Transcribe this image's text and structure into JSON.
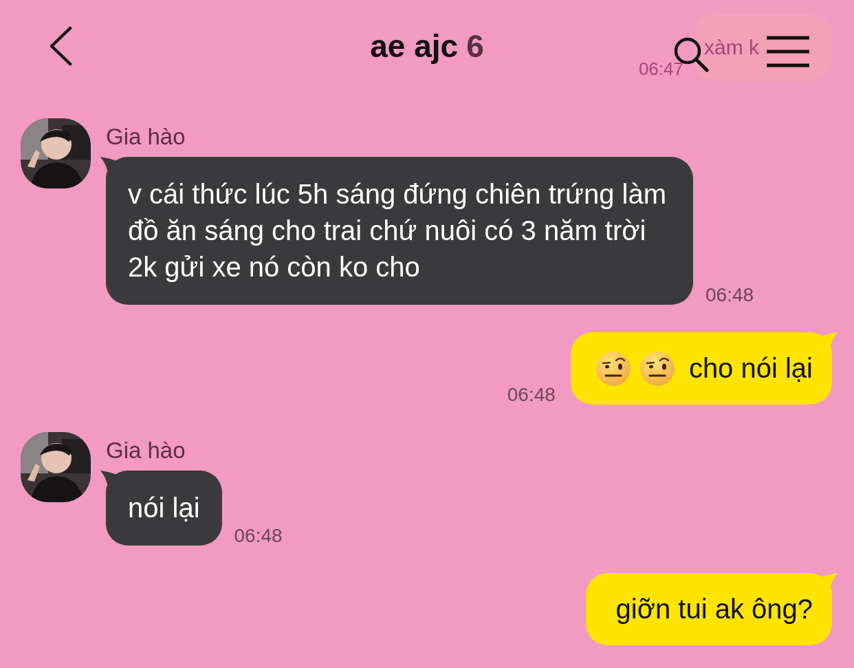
{
  "header": {
    "title": "ae ajc",
    "member_count": "6"
  },
  "faded_message": {
    "text": "xàm k",
    "time": "06:47"
  },
  "messages": [
    {
      "kind": "incoming",
      "sender": "Gia hào",
      "text": "v cái thức lúc 5h sáng đứng chiên trứng làm đồ ăn sáng cho trai chứ nuôi có 3 năm trời 2k gửi xe nó còn ko cho",
      "time": "06:48"
    },
    {
      "kind": "outgoing",
      "emojis": [
        {
          "kind": "raised-eyebrow"
        },
        {
          "kind": "raised-eyebrow"
        }
      ],
      "text": "cho nói lại",
      "time": "06:48"
    },
    {
      "kind": "incoming",
      "sender": "Gia hào",
      "text": "nói lại",
      "time": "06:48"
    },
    {
      "kind": "outgoing",
      "text": "giỡn tui ak ông?"
    }
  ]
}
